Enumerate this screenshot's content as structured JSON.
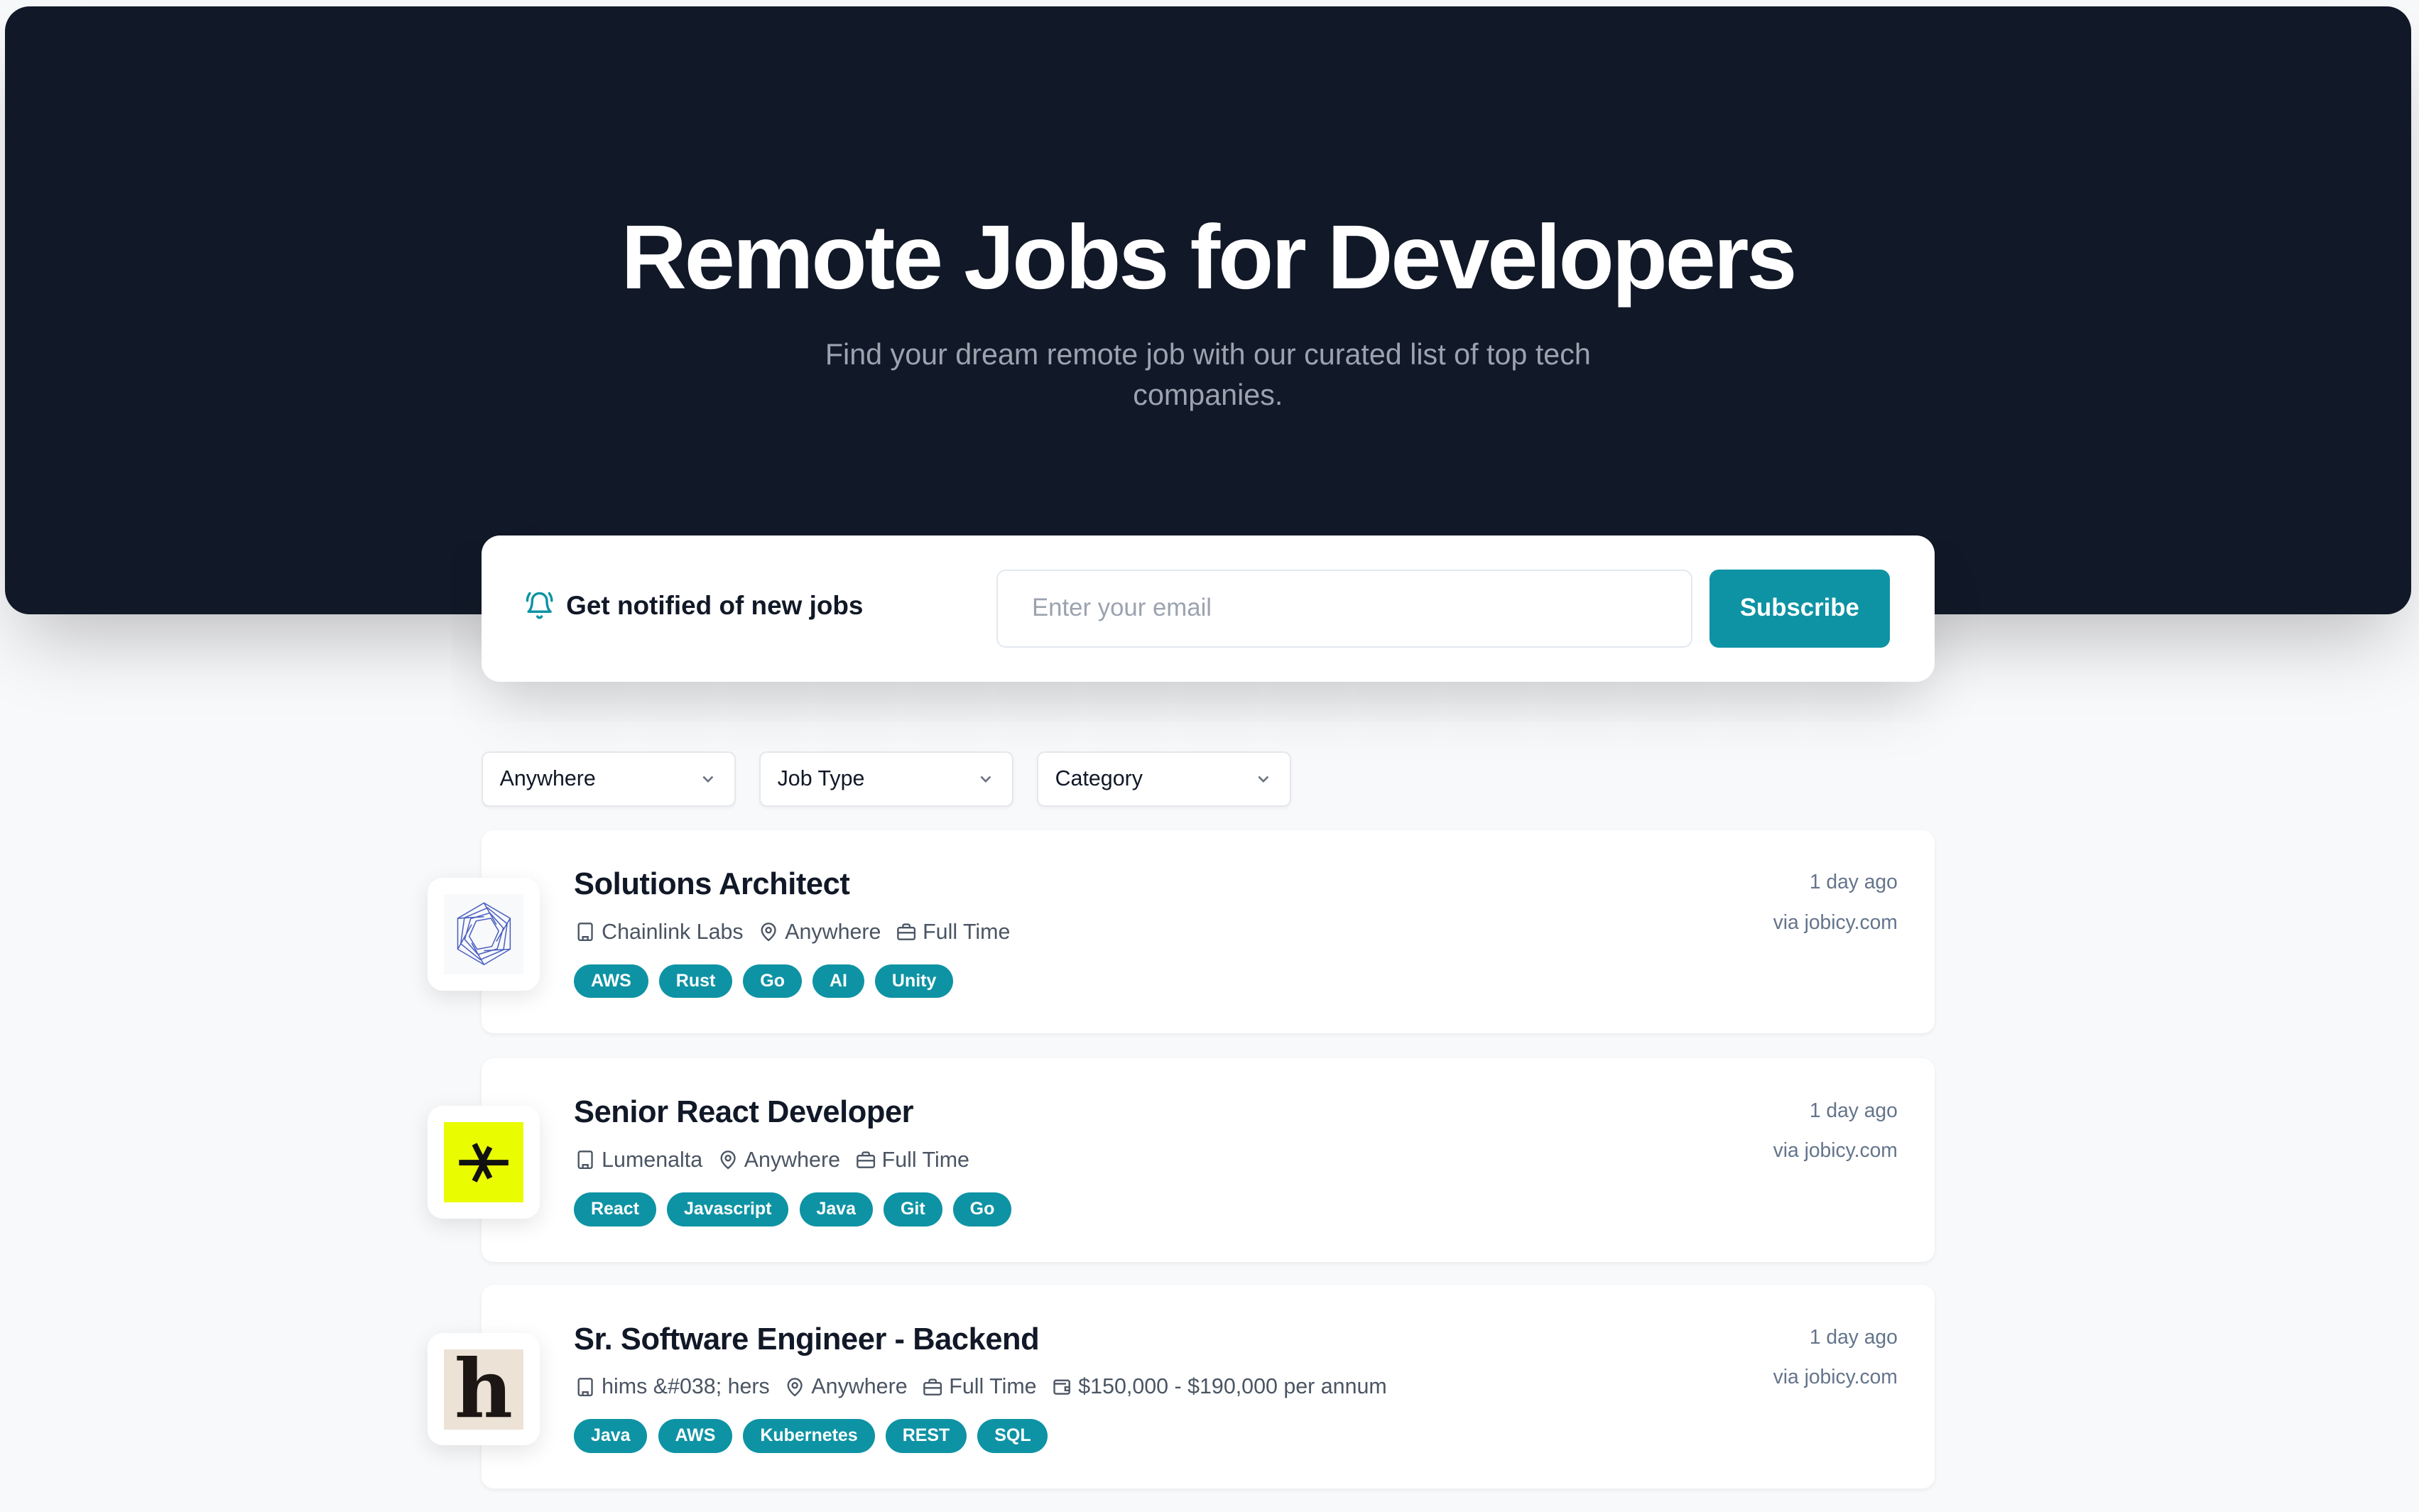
{
  "hero": {
    "title": "Remote Jobs for Developers",
    "subtitle": "Find your dream remote job with our curated list of top tech companies."
  },
  "notify": {
    "icon": "bell-ring-icon",
    "label": "Get notified of new jobs",
    "email_placeholder": "Enter your email",
    "email_value": "",
    "subscribe_label": "Subscribe"
  },
  "filters": [
    {
      "label": "Anywhere",
      "icon": "chevron-down-icon"
    },
    {
      "label": "Job Type",
      "icon": "chevron-down-icon"
    },
    {
      "label": "Category",
      "icon": "chevron-down-icon"
    }
  ],
  "colors": {
    "hero_bg": "#111827",
    "accent": "#0e93a4",
    "page_bg": "#f8f9fb",
    "muted_text": "#64748b"
  },
  "jobs": [
    {
      "title": "Solutions Architect",
      "company": "Chainlink Labs",
      "location": "Anywhere",
      "job_type": "Full Time",
      "salary": null,
      "posted": "1 day ago",
      "source": "via jobicy.com",
      "logo": "chainlink-labs-logo",
      "tags": [
        "AWS",
        "Rust",
        "Go",
        "AI",
        "Unity"
      ]
    },
    {
      "title": "Senior React Developer",
      "company": "Lumenalta",
      "location": "Anywhere",
      "job_type": "Full Time",
      "salary": null,
      "posted": "1 day ago",
      "source": "via jobicy.com",
      "logo": "lumenalta-logo",
      "tags": [
        "React",
        "Javascript",
        "Java",
        "Git",
        "Go"
      ]
    },
    {
      "title": "Sr. Software Engineer - Backend",
      "company": "hims &#038; hers",
      "location": "Anywhere",
      "job_type": "Full Time",
      "salary": "$150,000 - $190,000 per annum",
      "posted": "1 day ago",
      "source": "via jobicy.com",
      "logo": "hims-hers-logo",
      "tags": [
        "Java",
        "AWS",
        "Kubernetes",
        "REST",
        "SQL"
      ]
    }
  ]
}
